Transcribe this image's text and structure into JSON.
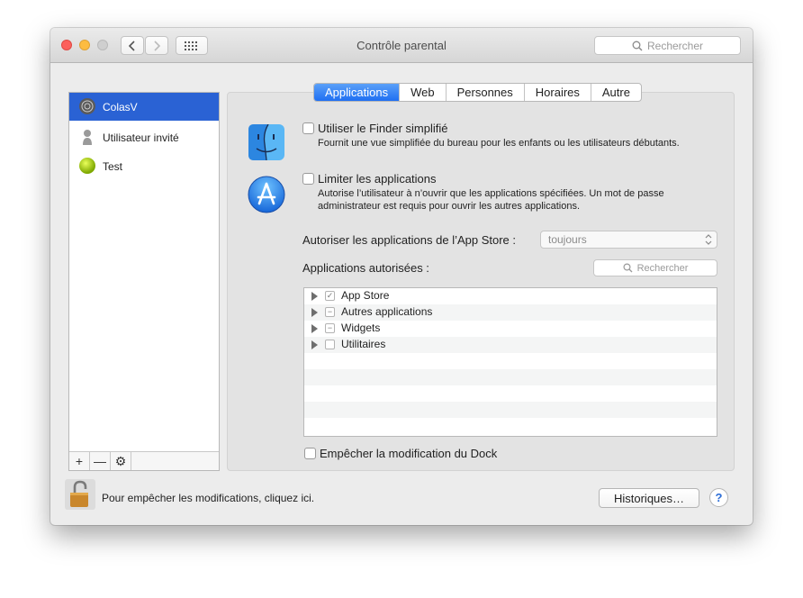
{
  "window": {
    "title": "Contrôle parental",
    "search_placeholder": "Rechercher"
  },
  "sidebar": {
    "users": [
      {
        "name": "ColasV",
        "selected": true
      },
      {
        "name": "Utilisateur invité",
        "selected": false
      },
      {
        "name": "Test",
        "selected": false
      }
    ],
    "tools": [
      "+",
      "—",
      "⚙"
    ]
  },
  "tabs": [
    {
      "label": "Applications",
      "active": true
    },
    {
      "label": "Web",
      "active": false
    },
    {
      "label": "Personnes",
      "active": false
    },
    {
      "label": "Horaires",
      "active": false
    },
    {
      "label": "Autre",
      "active": false
    }
  ],
  "options": {
    "finder": {
      "label": "Utiliser le Finder simplifié",
      "desc": "Fournit une vue simplifiée du bureau pour les enfants ou les utilisateurs débutants.",
      "checked": false
    },
    "limit": {
      "label": "Limiter les applications",
      "desc_line1": "Autorise l’utilisateur à n’ouvrir que les applications spécifiées. Un mot de passe",
      "desc_line2": "administrateur est requis pour ouvrir les autres applications.",
      "checked": false
    }
  },
  "appstore": {
    "label": "Autoriser les applications de l’App Store :",
    "value": "toujours"
  },
  "allowed": {
    "label": "Applications autorisées :",
    "search_placeholder": "Rechercher"
  },
  "app_list": [
    {
      "name": "App Store",
      "state": "✓"
    },
    {
      "name": "Autres applications",
      "state": "−"
    },
    {
      "name": "Widgets",
      "state": "−"
    },
    {
      "name": "Utilitaires",
      "state": ""
    }
  ],
  "dock": {
    "label": "Empêcher la modification du Dock",
    "checked": false
  },
  "bottom": {
    "lock_text": "Pour empêcher les modifications, cliquez ici.",
    "history_label": "Historiques…",
    "help_label": "?"
  },
  "colors": {
    "accent": "#2a62d4",
    "tab_active": "#1f6ff2"
  }
}
